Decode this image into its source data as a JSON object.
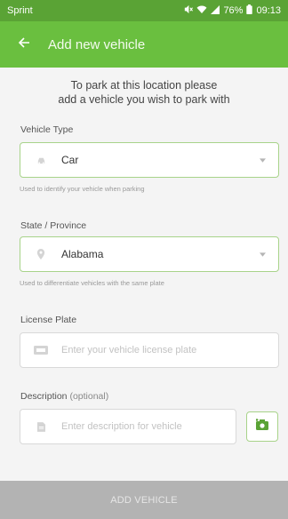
{
  "status_bar": {
    "carrier": "Sprint",
    "battery": "76%",
    "time": "09:13",
    "icons": [
      "mute-icon",
      "wifi-icon",
      "signal-icon",
      "battery-icon"
    ]
  },
  "app_bar": {
    "title": "Add new vehicle",
    "back_icon": "arrow-left-icon"
  },
  "intro_line1": "To park at this location please",
  "intro_line2": "add a vehicle you wish to park with",
  "vehicle_type": {
    "label": "Vehicle Type",
    "value": "Car",
    "helper": "Used to identify your vehicle when parking",
    "icon": "car-icon"
  },
  "state": {
    "label": "State / Province",
    "value": "Alabama",
    "helper": "Used to differentiate vehicles with the same plate",
    "icon": "location-pin-icon"
  },
  "license_plate": {
    "label": "License Plate",
    "placeholder": "Enter your vehicle license plate",
    "icon": "license-plate-icon"
  },
  "description": {
    "label": "Description",
    "label_suffix": "(optional)",
    "placeholder": "Enter description for vehicle",
    "icon": "document-icon"
  },
  "camera_icon": "add-photo-icon",
  "submit": {
    "label": "ADD VEHICLE"
  },
  "colors": {
    "status_bar": "#5aa335",
    "app_bar": "#6abf3f",
    "accent": "#5aa335",
    "disabled_button": "#b3b3b3"
  }
}
